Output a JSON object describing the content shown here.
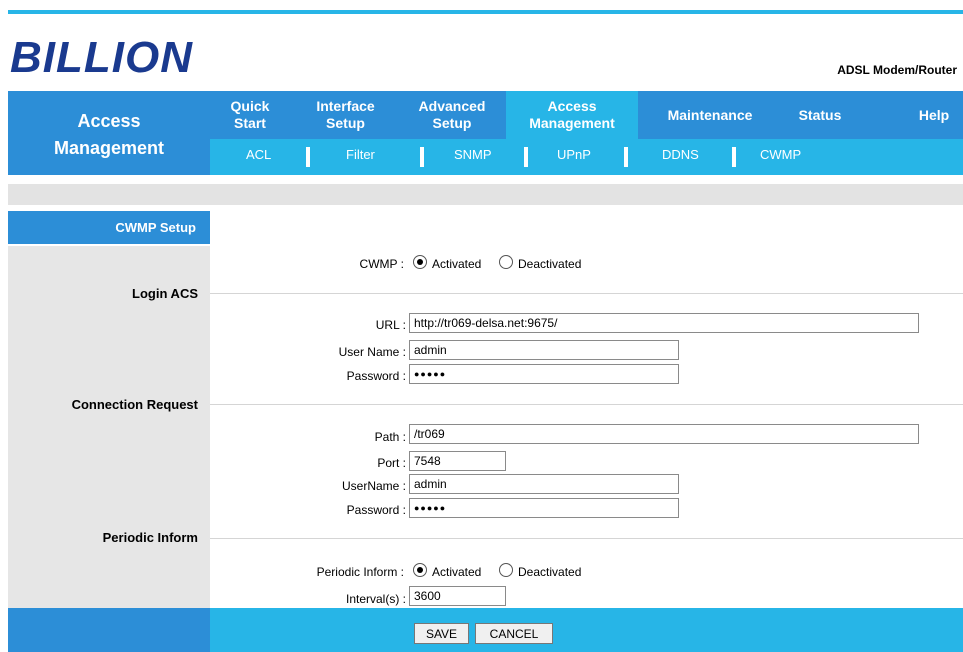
{
  "brand": {
    "logo_text": "BILLION",
    "product": "ADSL Modem/Router"
  },
  "section_title": {
    "line1": "Access",
    "line2": "Management"
  },
  "nav": {
    "items": [
      {
        "l1": "Quick",
        "l2": "Start"
      },
      {
        "l1": "Interface",
        "l2": "Setup"
      },
      {
        "l1": "Advanced",
        "l2": "Setup"
      },
      {
        "l1": "Access",
        "l2": "Management"
      },
      {
        "l1": "Maintenance",
        "l2": ""
      },
      {
        "l1": "Status",
        "l2": ""
      },
      {
        "l1": "Help",
        "l2": ""
      }
    ]
  },
  "subnav": {
    "items": [
      "ACL",
      "Filter",
      "SNMP",
      "UPnP",
      "DDNS",
      "CWMP"
    ]
  },
  "sidebar": {
    "cwmp_setup": "CWMP Setup",
    "login_acs": "Login ACS",
    "connection_request": "Connection Request",
    "periodic_inform": "Periodic Inform"
  },
  "form": {
    "cwmp": {
      "label": "CWMP :",
      "opt1": "Activated",
      "opt2": "Deactivated",
      "selected": "Activated"
    },
    "acs": {
      "url_label": "URL :",
      "url": "http://tr069-delsa.net:9675/",
      "user_label": "User Name :",
      "user": "admin",
      "pass_label": "Password :",
      "pass": "●●●●●"
    },
    "conn": {
      "path_label": "Path :",
      "path": "/tr069",
      "port_label": "Port :",
      "port": "7548",
      "user_label": "UserName :",
      "user": "admin",
      "pass_label": "Password :",
      "pass": "●●●●●"
    },
    "periodic": {
      "label": "Periodic Inform :",
      "opt1": "Activated",
      "opt2": "Deactivated",
      "selected": "Activated",
      "interval_label": "Interval(s) :",
      "interval": "3600"
    }
  },
  "buttons": {
    "save": "SAVE",
    "cancel": "CANCEL"
  },
  "colors": {
    "dark_blue": "#2c8ed7",
    "light_blue": "#27b5e7",
    "grey": "#e6e6e6"
  }
}
